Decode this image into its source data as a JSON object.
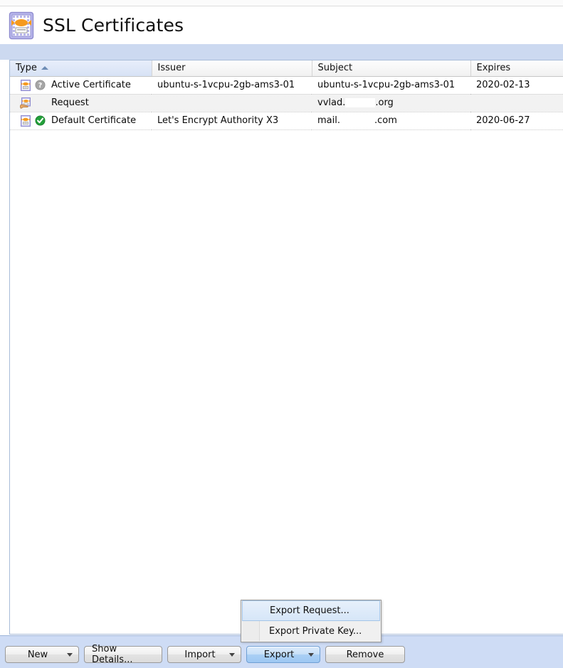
{
  "page": {
    "title": "SSL Certificates",
    "title_icon": "certificate-icon"
  },
  "table": {
    "columns": [
      {
        "key": "type",
        "label": "Type",
        "sorted": true,
        "sort_direction": "asc"
      },
      {
        "key": "issuer",
        "label": "Issuer",
        "sorted": false
      },
      {
        "key": "subject",
        "label": "Subject",
        "sorted": false
      },
      {
        "key": "expires",
        "label": "Expires",
        "sorted": false
      }
    ],
    "rows": [
      {
        "type": "Active Certificate",
        "badge": "question-mark-badge",
        "row_icon": "certificate-icon",
        "issuer": "ubuntu-s-1vcpu-2gb-ams3-01",
        "subject_prefix": "ubuntu-s-1vcpu-2gb-ams3-01",
        "subject_suffix": "",
        "redacted": false,
        "expires": "2020-02-13",
        "alt": false
      },
      {
        "type": "Request",
        "badge": "none",
        "row_icon": "certificate-request-icon",
        "issuer": "",
        "subject_prefix": "vvlad.",
        "subject_suffix": ".org",
        "redacted": true,
        "expires": "",
        "alt": true
      },
      {
        "type": "Default Certificate",
        "badge": "green-check-badge",
        "row_icon": "certificate-icon",
        "issuer": "Let's Encrypt Authority X3",
        "subject_prefix": "mail.",
        "subject_suffix": ".com",
        "redacted": true,
        "expires": "2020-06-27",
        "alt": false
      }
    ]
  },
  "toolbar": {
    "new_label": "New",
    "show_details_label": "Show Details...",
    "import_label": "Import",
    "export_label": "Export",
    "remove_label": "Remove"
  },
  "menu": {
    "items": [
      {
        "label": "Export Request...",
        "highlighted": true
      },
      {
        "label": "Export Private Key...",
        "highlighted": false
      }
    ]
  },
  "colors": {
    "band": "#ccd9f0",
    "footer": "#cedcf5",
    "accent": "#9ec8f3",
    "grid_border": "#a8bcd8",
    "badge_green": "#23a03a",
    "badge_gray": "#9a9a9a"
  }
}
